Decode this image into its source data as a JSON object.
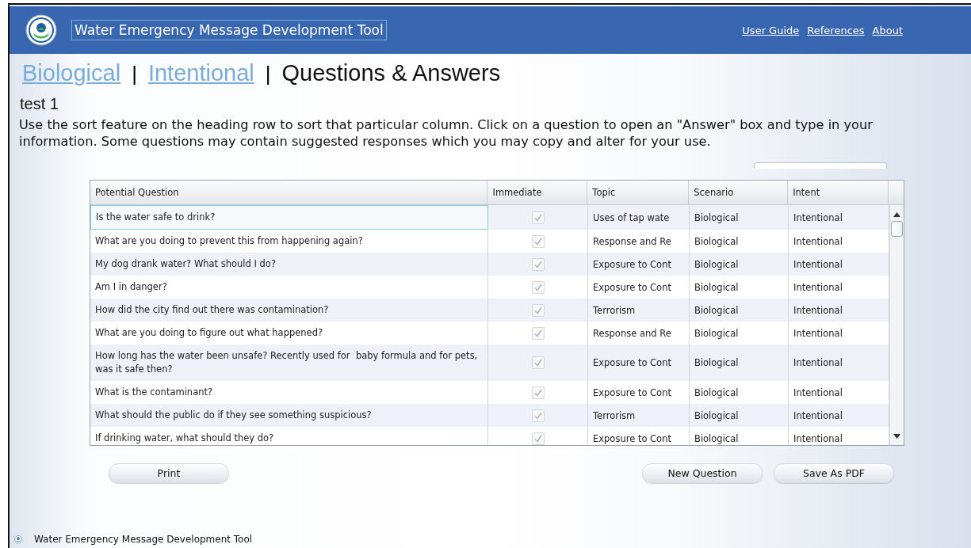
{
  "header": {
    "title": "Water Emergency Message Development Tool",
    "links": [
      "User Guide",
      "References",
      "About"
    ]
  },
  "breadcrumb": [
    {
      "label": "Biological",
      "kind": "link"
    },
    {
      "label": "|",
      "kind": "separator"
    },
    {
      "label": "Intentional",
      "kind": "link"
    },
    {
      "label": "|",
      "kind": "separator"
    },
    {
      "label": "Questions & Answers",
      "kind": "current"
    }
  ],
  "heading": "test 1",
  "instructions": "Use the sort feature on the heading row to sort that particular column. Click on a question to open an \"Answer\" box and type in your information. Some questions may contain suggested responses which you may copy and alter for your use.",
  "table": {
    "columns": [
      "Potential Question",
      "Immediate",
      "Topic",
      "Scenario",
      "Intent"
    ],
    "rows": [
      {
        "question": "Is the water safe to drink?",
        "immediate": true,
        "topic": "Uses of tap wate",
        "scenario": "Biological",
        "intent": "Intentional",
        "selected": true
      },
      {
        "question": "What are you doing to prevent this from happening again?",
        "immediate": true,
        "topic": "Response and Re",
        "scenario": "Biological",
        "intent": "Intentional",
        "selected": false
      },
      {
        "question": "My dog drank water? What should I do?",
        "immediate": true,
        "topic": "Exposure to Cont",
        "scenario": "Biological",
        "intent": "Intentional",
        "selected": false
      },
      {
        "question": "Am I in danger?",
        "immediate": true,
        "topic": "Exposure to Cont",
        "scenario": "Biological",
        "intent": "Intentional",
        "selected": false
      },
      {
        "question": "How did the city find out there was contamination?",
        "immediate": true,
        "topic": "Terrorism",
        "scenario": "Biological",
        "intent": "Intentional",
        "selected": false
      },
      {
        "question": "What are you doing to figure out what happened?",
        "immediate": true,
        "topic": "Response and Re",
        "scenario": "Biological",
        "intent": "Intentional",
        "selected": false
      },
      {
        "question": "How long has the water been unsafe? Recently used for  baby formula and for pets, was it safe then?",
        "immediate": true,
        "topic": "Exposure to Cont",
        "scenario": "Biological",
        "intent": "Intentional",
        "selected": false
      },
      {
        "question": "What is the contaminant?",
        "immediate": true,
        "topic": "Exposure to Cont",
        "scenario": "Biological",
        "intent": "Intentional",
        "selected": false
      },
      {
        "question": "What should the public do if they see something suspicious?",
        "immediate": true,
        "topic": "Terrorism",
        "scenario": "Biological",
        "intent": "Intentional",
        "selected": false
      },
      {
        "question": "If drinking water, what should they do?",
        "immediate": true,
        "topic": "Exposure to Cont",
        "scenario": "Biological",
        "intent": "Intentional",
        "selected": false
      }
    ]
  },
  "buttons": {
    "left": [
      "Print"
    ],
    "right": [
      "New Question",
      "Save As PDF"
    ]
  },
  "status_bar": {
    "text": "Water Emergency Message Development Tool"
  }
}
